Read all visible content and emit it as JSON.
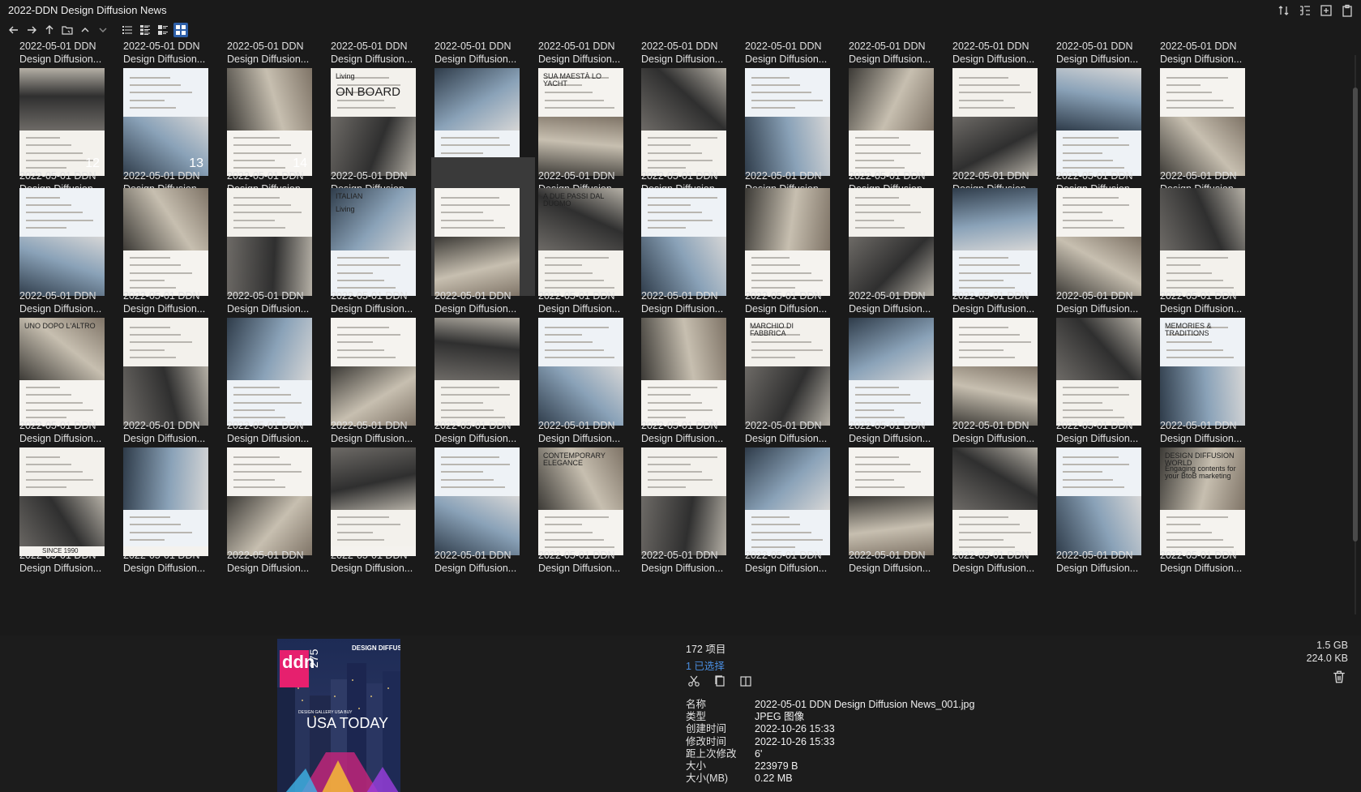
{
  "window": {
    "title": "2022-DDN Design Diffusion News"
  },
  "grid": {
    "caption_line1": "2022-05-01 DDN",
    "caption_line2": "Design Diffusion...",
    "columns": 12,
    "selected_row": 1,
    "selected_col": 4,
    "thumbnail_text": {
      "r0c0": "12",
      "r0c1": "13",
      "r0c2": "14",
      "r0c3_a": "Living",
      "r0c3_b": "ON BOARD",
      "r0c5": "SUA MAESTÀ LO YACHT",
      "r1c3_a": "ITALIAN",
      "r1c3_b": "Living",
      "r1c5": "A DUE PASSI DAL DUOMO",
      "r2c0": "UNO DOPO L'ALTRO",
      "r2c7": "MARCHIO DI FABBRICA",
      "r2c11": "MEMORIES & TRADITIONS",
      "r3c5": "CONTEMPORARY ELEGANCE",
      "r3c11_a": "DESIGN DIFFUSION WORLD",
      "r3c11_b": "Engaging contents for your BtoB marketing",
      "r4c0": "SINCE 1990"
    }
  },
  "preview": {
    "logo": "ddn",
    "issue": "275",
    "brand": "DESIGN DIFFUSION NEWS",
    "headline": "USA TODAY",
    "kicker": "DESIGN GALLERY USA BUY"
  },
  "info": {
    "item_count": "172 项目",
    "selected": "1 已选择",
    "total_size": "1.5 GB",
    "selected_size": "224.0 KB",
    "properties": [
      {
        "key": "名称",
        "value": "2022-05-01 DDN Design Diffusion News_001.jpg"
      },
      {
        "key": "类型",
        "value": "JPEG 图像"
      },
      {
        "key": "创建时间",
        "value": "2022-10-26  15:33"
      },
      {
        "key": "修改时间",
        "value": "2022-10-26  15:33"
      },
      {
        "key": "距上次修改",
        "value": "6'"
      },
      {
        "key": "大小",
        "value": "223979 B"
      },
      {
        "key": "大小(MB)",
        "value": "0.22 MB"
      }
    ]
  },
  "icons": {
    "toolbar": [
      "back-icon",
      "forward-icon",
      "up-icon",
      "folder-icon",
      "chevron-up-icon",
      "chevron-down-icon",
      "list-view-icon",
      "details-view-icon",
      "tiles-view-icon",
      "grid-view-icon"
    ],
    "titlebar": [
      "sort-icon",
      "tree-view-icon",
      "new-tab-icon",
      "clipboard-icon"
    ],
    "actions": [
      "cut-icon",
      "copy-icon",
      "open-in-icon",
      "trash-icon"
    ]
  },
  "colors": {
    "accent": "#2d5fa8",
    "link": "#4a8ee0",
    "background": "#1a1a1a"
  }
}
